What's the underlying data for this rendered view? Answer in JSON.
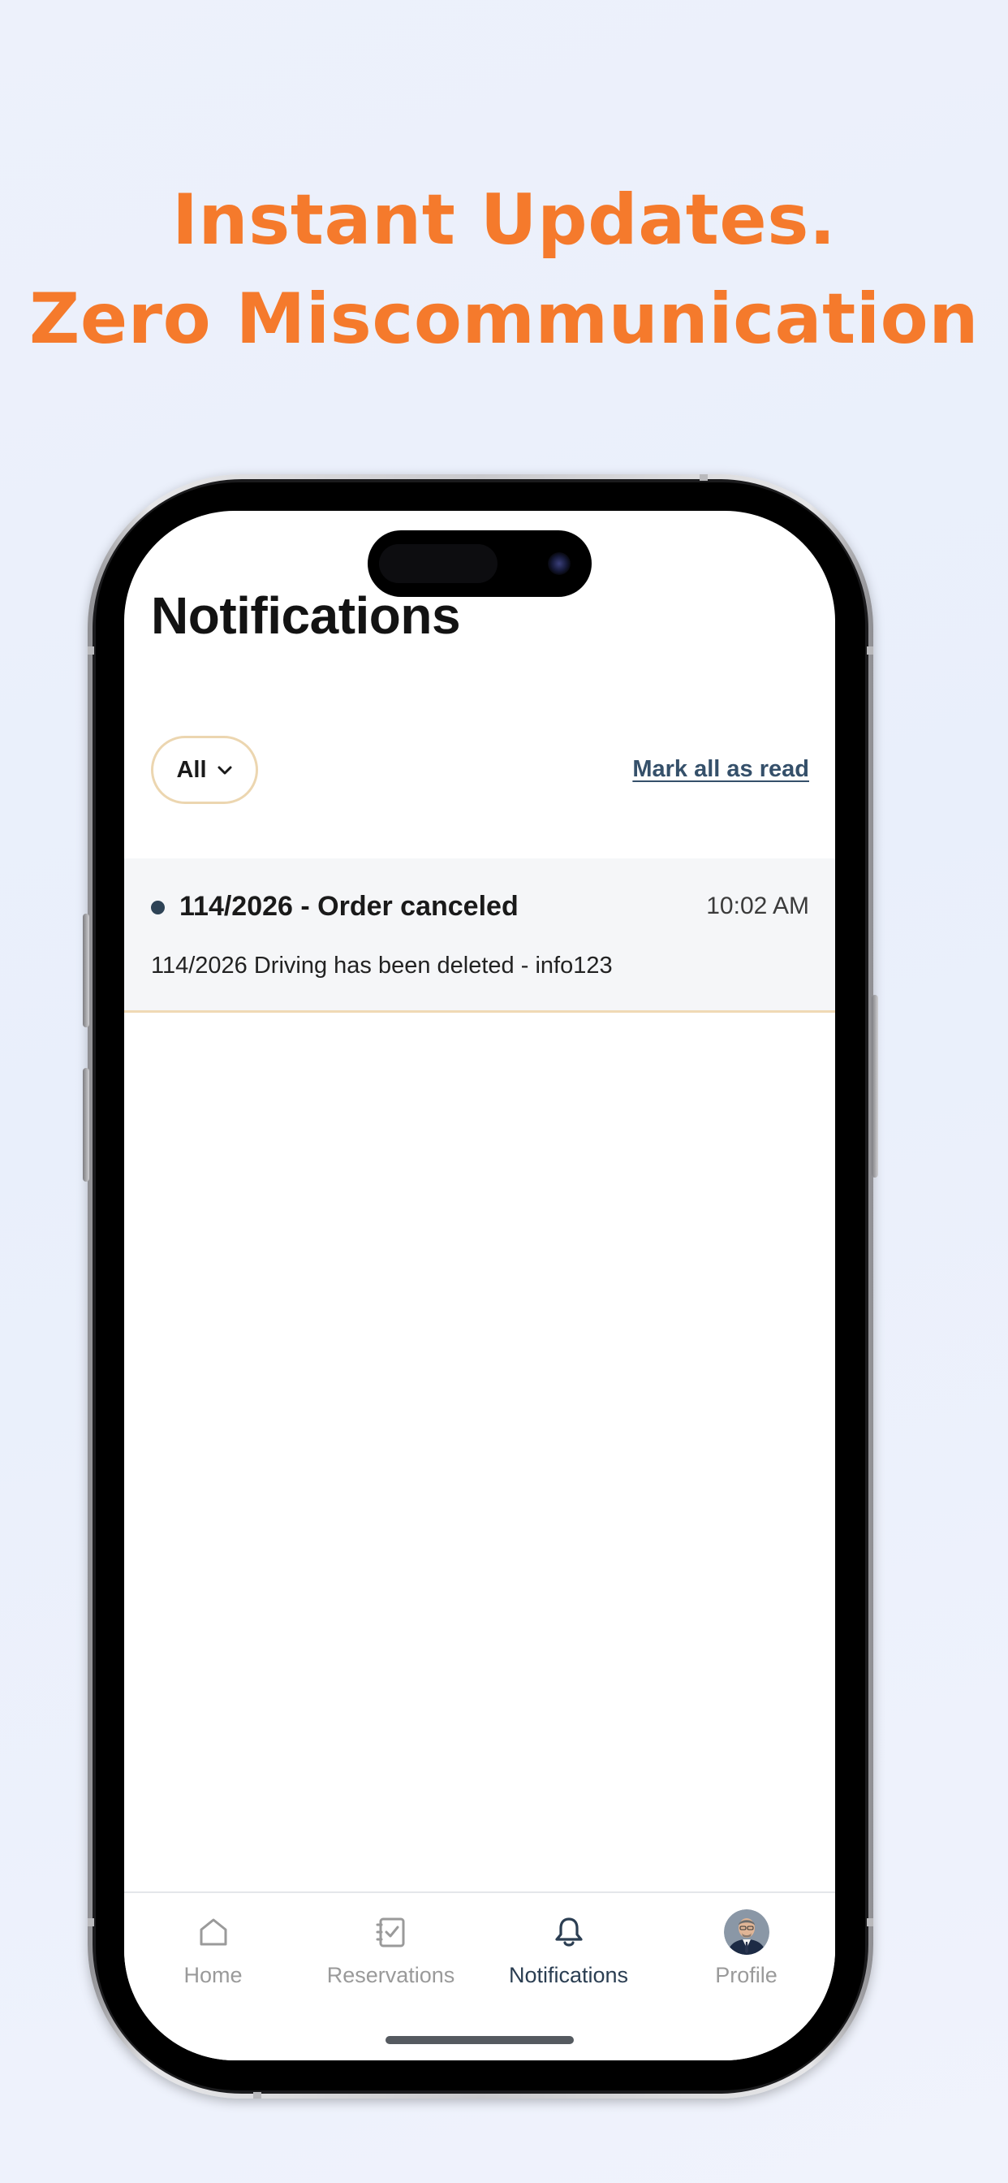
{
  "promo": {
    "headline_line1": "Instant Updates.",
    "headline_line2": "Zero Miscommunication",
    "accent_color": "#f57a2c"
  },
  "screen": {
    "title": "Notifications",
    "filter": {
      "selected": "All",
      "icon": "chevron-down-icon"
    },
    "mark_all_label": "Mark all as read",
    "notifications": [
      {
        "title": "114/2026 - Order canceled",
        "time": "10:02 AM",
        "body": "114/2026 Driving has been deleted - info123",
        "unread": true
      }
    ]
  },
  "tabbar": {
    "items": [
      {
        "label": "Home",
        "icon": "home-icon",
        "active": false
      },
      {
        "label": "Reservations",
        "icon": "checklist-icon",
        "active": false
      },
      {
        "label": "Notifications",
        "icon": "bell-icon",
        "active": true
      },
      {
        "label": "Profile",
        "icon": "avatar",
        "active": false
      }
    ]
  },
  "colors": {
    "active_tab": "#2b3e52",
    "inactive_tab": "#9a9a9a",
    "chip_border": "#ecd6b0",
    "unread_dot": "#2e4356"
  }
}
